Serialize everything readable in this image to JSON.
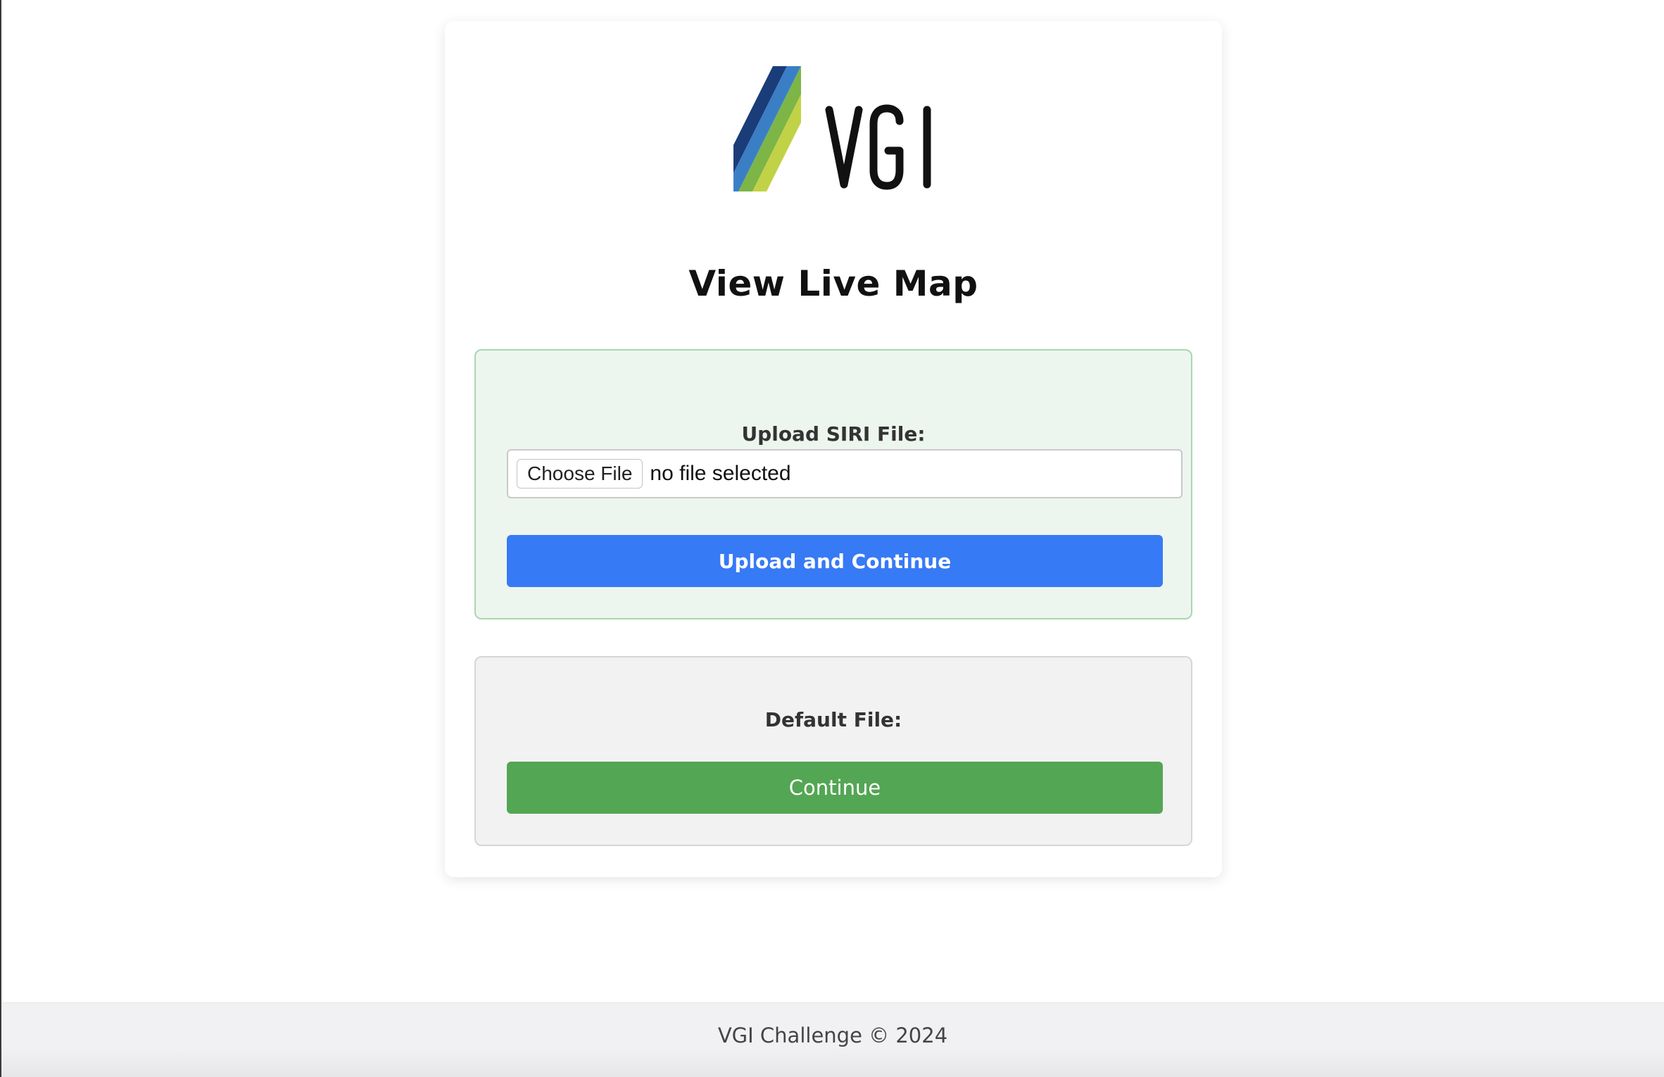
{
  "brand": {
    "logo_text": "VGI",
    "colors": [
      "#1a3d7a",
      "#3a7fc6",
      "#7db547",
      "#c2d246"
    ]
  },
  "main": {
    "title": "View Live Map"
  },
  "upload": {
    "label": "Upload SIRI File:",
    "choose_button_label": "Choose File",
    "file_status": "no file selected",
    "submit_label": "Upload and Continue",
    "accent": "#377af5"
  },
  "default_file": {
    "label": "Default File:",
    "continue_label": "Continue",
    "accent": "#53a653"
  },
  "footer": {
    "text": "VGI Challenge © 2024"
  }
}
